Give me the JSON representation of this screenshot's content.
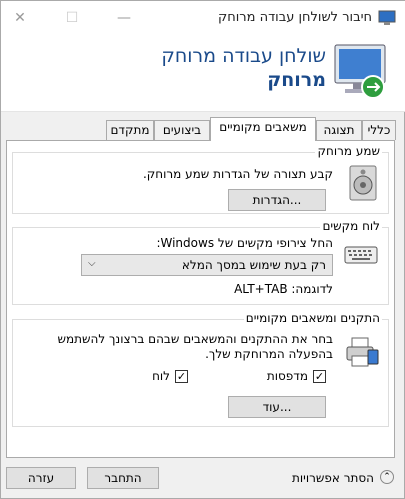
{
  "window": {
    "title": "חיבור לשולחן עבודה מרוחק",
    "minimize_icon": "—",
    "maximize_icon": "☐",
    "close_icon": "✕"
  },
  "header": {
    "line1": "שולחן עבודה מרוחק",
    "line2": "מרוחק",
    "icon": "remote-desktop-monitor-icon"
  },
  "tabs": [
    {
      "label": "כללי",
      "active": false
    },
    {
      "label": "תצוגה",
      "active": false
    },
    {
      "label": "משאבים מקומיים",
      "active": true
    },
    {
      "label": "ביצועים",
      "active": false
    },
    {
      "label": "מתקדם",
      "active": false
    }
  ],
  "sections": {
    "audio": {
      "title": "שמע מרוחק",
      "description": "קבע תצורה של הגדרות שמע מרוחק.",
      "button": "הגדרות...",
      "icon": "speaker-icon"
    },
    "keyboard": {
      "title": "לוח מקשים",
      "description": "החל צירופי מקשים של Windows:",
      "selected": "רק בעת שימוש במסך המלא",
      "example": "לדוגמה: ALT+TAB",
      "icon": "keyboard-icon"
    },
    "devices": {
      "title": "התקנים ומשאבים מקומיים",
      "description_line1": "בחר את ההתקנים והמשאבים שבהם ברצונך להשתמש",
      "description_line2": "בהפעלה המרוחקת שלך.",
      "printers_label": "מדפסות",
      "printers_checked": true,
      "clipboard_label": "לוח",
      "clipboard_checked": true,
      "more_button": "עוד...",
      "icon": "printer-devices-icon"
    }
  },
  "footer": {
    "hide_options": "הסתר אפשרויות",
    "connect": "התחבר",
    "help": "עזרה"
  }
}
